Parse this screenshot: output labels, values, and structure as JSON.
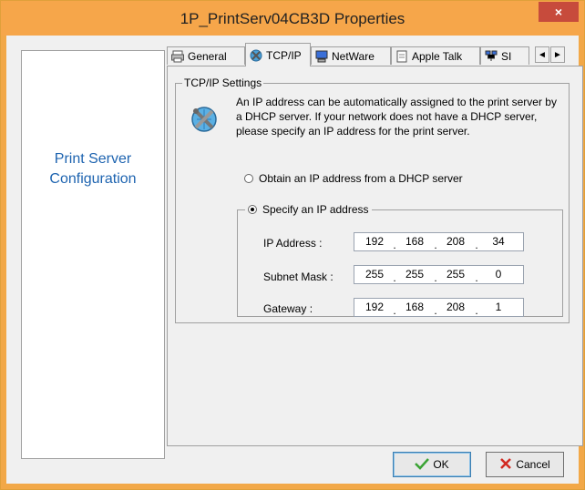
{
  "window": {
    "title": "1P_PrintServ04CB3D Properties",
    "close_glyph": "×",
    "accent_color": "#f6a64a"
  },
  "left_panel": {
    "line1": "Print Server",
    "line2": "Configuration",
    "text_color": "#1e64b0"
  },
  "tabs": [
    {
      "label": "General",
      "icon": "printer-icon"
    },
    {
      "label": "TCP/IP",
      "icon": "network-tools-icon",
      "active": true
    },
    {
      "label": "NetWare",
      "icon": "computer-icon"
    },
    {
      "label": "Apple Talk",
      "icon": "document-icon"
    },
    {
      "label": "SI",
      "icon": "network-icon"
    }
  ],
  "tab_scroll": {
    "left": "◄",
    "right": "►"
  },
  "tcpip": {
    "group_title": "TCP/IP Settings",
    "description": "An IP address can be automatically assigned to the print server by a DHCP server. If your network does not have a DHCP server, please specify an IP address for the print server.",
    "radio_dhcp": {
      "label": "Obtain an IP address from a DHCP server",
      "checked": false
    },
    "radio_specify": {
      "label": "Specify an IP address",
      "checked": true
    },
    "fields": {
      "ip": {
        "label": "IP Address :",
        "octets": [
          "192",
          "168",
          "208",
          "34"
        ]
      },
      "subnet": {
        "label": "Subnet Mask :",
        "octets": [
          "255",
          "255",
          "255",
          "0"
        ]
      },
      "gateway": {
        "label": "Gateway :",
        "octets": [
          "192",
          "168",
          "208",
          "1"
        ]
      }
    }
  },
  "buttons": {
    "ok": {
      "label": "OK",
      "icon": "checkmark-icon"
    },
    "cancel": {
      "label": "Cancel",
      "icon": "x-icon"
    }
  }
}
